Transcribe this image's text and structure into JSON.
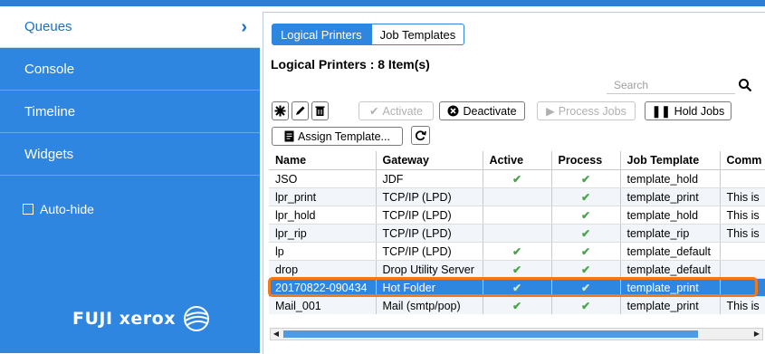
{
  "sidebar": {
    "items": [
      {
        "label": "Queues",
        "active": true
      },
      {
        "label": "Console",
        "active": false
      },
      {
        "label": "Timeline",
        "active": false
      },
      {
        "label": "Widgets",
        "active": false
      }
    ],
    "autohide_label": "Auto-hide",
    "logo_text": "FUJI xerox"
  },
  "tabs": [
    {
      "label": "Logical Printers",
      "selected": true
    },
    {
      "label": "Job Templates",
      "selected": false
    }
  ],
  "heading": "Logical Printers : 8 Item(s)",
  "search": {
    "placeholder": "Search",
    "value": ""
  },
  "toolbar": {
    "activate": "Activate",
    "deactivate": "Deactivate",
    "process_jobs": "Process Jobs",
    "hold_jobs": "Hold Jobs",
    "assign_template": "Assign Template..."
  },
  "table": {
    "columns": [
      "Name",
      "Gateway",
      "Active",
      "Process",
      "Job Template",
      "Comm"
    ],
    "rows": [
      {
        "name": "JSO",
        "gateway": "JDF",
        "active": true,
        "process": true,
        "template": "template_hold",
        "comment": ""
      },
      {
        "name": "lpr_print",
        "gateway": "TCP/IP (LPD)",
        "active": false,
        "process": true,
        "template": "template_print",
        "comment": "This is"
      },
      {
        "name": "lpr_hold",
        "gateway": "TCP/IP (LPD)",
        "active": false,
        "process": true,
        "template": "template_hold",
        "comment": "This is"
      },
      {
        "name": "lpr_rip",
        "gateway": "TCP/IP (LPD)",
        "active": false,
        "process": true,
        "template": "template_rip",
        "comment": "This is"
      },
      {
        "name": "lp",
        "gateway": "TCP/IP (LPD)",
        "active": true,
        "process": true,
        "template": "template_default",
        "comment": ""
      },
      {
        "name": "drop",
        "gateway": "Drop Utility Server",
        "active": true,
        "process": true,
        "template": "template_default",
        "comment": ""
      },
      {
        "name": "20170822-090434",
        "gateway": "Hot Folder",
        "active": true,
        "process": true,
        "template": "template_print",
        "comment": "",
        "selected": true
      },
      {
        "name": "Mail_001",
        "gateway": "Mail (smtp/pop)",
        "active": true,
        "process": true,
        "template": "template_print",
        "comment": "This is"
      }
    ]
  },
  "colors": {
    "accent": "#2f86e0",
    "highlight": "#f07a17",
    "check": "#4aa34a"
  },
  "icons": [
    "chevron-right-icon",
    "search-icon",
    "new-icon",
    "edit-icon",
    "delete-icon",
    "check-icon",
    "cancel-circle-icon",
    "play-icon",
    "pause-icon",
    "template-icon",
    "refresh-icon"
  ]
}
